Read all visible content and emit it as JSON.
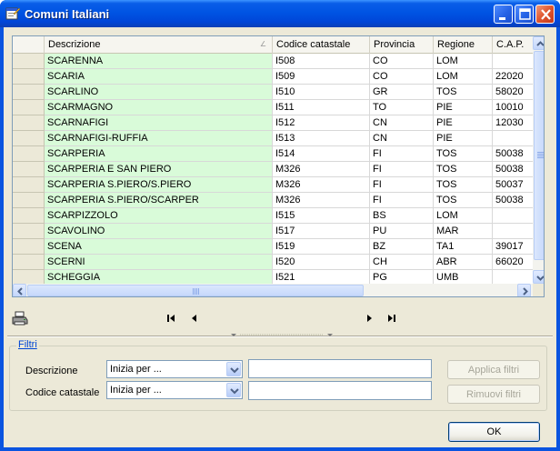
{
  "window": {
    "title": "Comuni Italiani"
  },
  "grid": {
    "columns": [
      "Descrizione",
      "Codice catastale",
      "Provincia",
      "Regione",
      "C.A.P."
    ],
    "sort_indicator": "∠",
    "rows": [
      [
        "SCARENNA",
        "I508",
        "CO",
        "LOM",
        ""
      ],
      [
        "SCARIA",
        "I509",
        "CO",
        "LOM",
        "22020"
      ],
      [
        "SCARLINO",
        "I510",
        "GR",
        "TOS",
        "58020"
      ],
      [
        "SCARMAGNO",
        "I511",
        "TO",
        "PIE",
        "10010"
      ],
      [
        "SCARNAFIGI",
        "I512",
        "CN",
        "PIE",
        "12030"
      ],
      [
        "SCARNAFIGI-RUFFIA",
        "I513",
        "CN",
        "PIE",
        ""
      ],
      [
        "SCARPERIA",
        "I514",
        "FI",
        "TOS",
        "50038"
      ],
      [
        "SCARPERIA E SAN PIERO",
        "M326",
        "FI",
        "TOS",
        "50038"
      ],
      [
        "SCARPERIA S.PIERO/S.PIERO",
        "M326",
        "FI",
        "TOS",
        "50037"
      ],
      [
        "SCARPERIA S.PIERO/SCARPER",
        "M326",
        "FI",
        "TOS",
        "50038"
      ],
      [
        "SCARPIZZOLO",
        "I515",
        "BS",
        "LOM",
        ""
      ],
      [
        "SCAVOLINO",
        "I517",
        "PU",
        "MAR",
        ""
      ],
      [
        "SCENA",
        "I519",
        "BZ",
        "TA1",
        "39017"
      ],
      [
        "SCERNI",
        "I520",
        "CH",
        "ABR",
        "66020"
      ],
      [
        "SCHEGGIA",
        "I521",
        "PG",
        "UMB",
        ""
      ]
    ]
  },
  "nav": {
    "icons": [
      "printer-icon",
      "first-record-icon",
      "previous-record-icon",
      "next-record-icon",
      "last-record-icon"
    ]
  },
  "filters": {
    "legend": "Filtri",
    "descrizione_label": "Descrizione",
    "descrizione_mode": "Inizia per ...",
    "descrizione_value": "",
    "codice_label": "Codice catastale",
    "codice_mode": "Inizia per ...",
    "codice_value": "",
    "apply_label": "Applica filtri",
    "remove_label": "Rimuovi filtri"
  },
  "footer": {
    "ok_label": "OK"
  },
  "colors": {
    "title_bar": "#0054e3",
    "description_cell": "#d9fbd9",
    "dialog_face": "#ece9d8",
    "filter_legend": "#0046d5"
  }
}
